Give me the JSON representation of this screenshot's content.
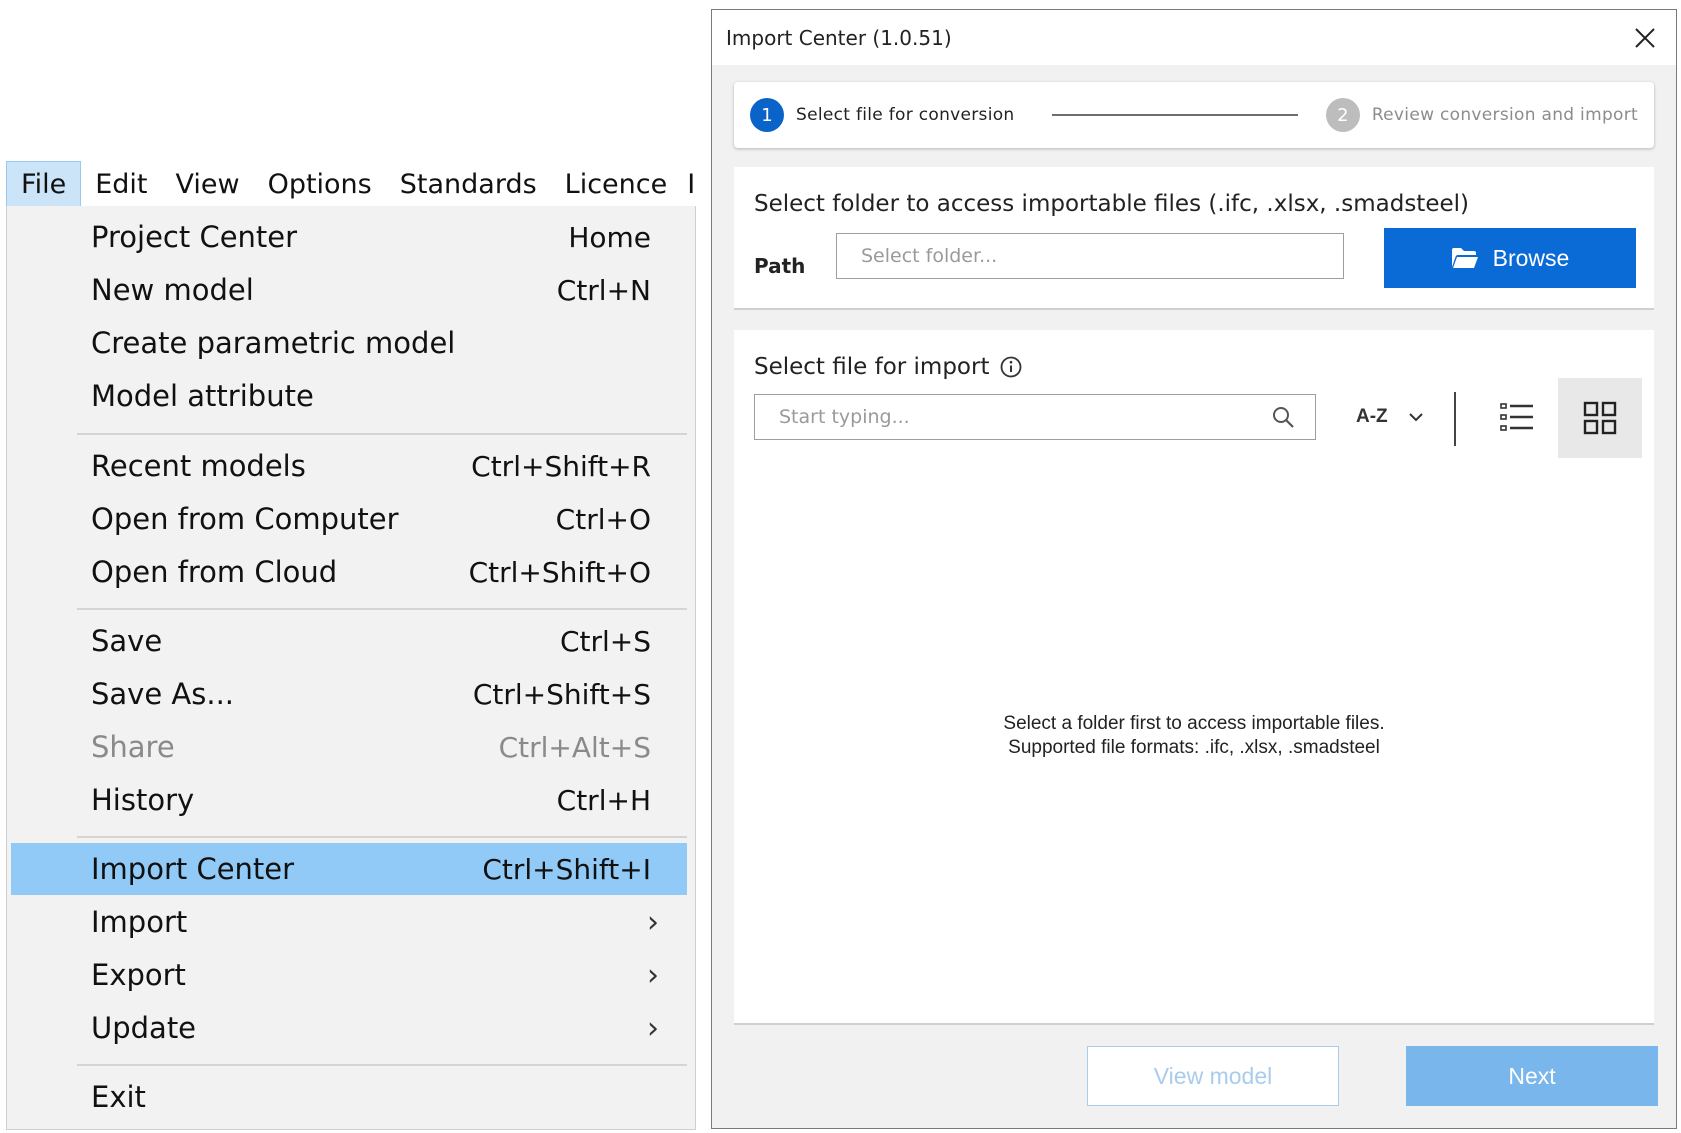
{
  "menubar": {
    "items": [
      "File",
      "Edit",
      "View",
      "Options",
      "Standards",
      "Licence",
      "I"
    ]
  },
  "file_menu": {
    "items": [
      {
        "label": "Project Center",
        "shortcut": "Home"
      },
      {
        "label": "New model",
        "shortcut": "Ctrl+N"
      },
      {
        "label": "Create parametric model",
        "shortcut": ""
      },
      {
        "label": "Model attribute",
        "shortcut": ""
      },
      {
        "label": "Recent models",
        "shortcut": "Ctrl+Shift+R"
      },
      {
        "label": "Open from Computer",
        "shortcut": "Ctrl+O"
      },
      {
        "label": "Open from Cloud",
        "shortcut": "Ctrl+Shift+O"
      },
      {
        "label": "Save",
        "shortcut": "Ctrl+S"
      },
      {
        "label": "Save As...",
        "shortcut": "Ctrl+Shift+S"
      },
      {
        "label": "Share",
        "shortcut": "Ctrl+Alt+S"
      },
      {
        "label": "History",
        "shortcut": "Ctrl+H"
      },
      {
        "label": "Import Center",
        "shortcut": "Ctrl+Shift+I"
      },
      {
        "label": "Import",
        "submenu_arrow": "›"
      },
      {
        "label": "Export",
        "submenu_arrow": "›"
      },
      {
        "label": "Update",
        "submenu_arrow": "›"
      },
      {
        "label": "Exit",
        "shortcut": ""
      }
    ]
  },
  "dialog": {
    "title": "Import Center (1.0.51)",
    "steps": [
      {
        "number": "1",
        "label": "Select file for conversion"
      },
      {
        "number": "2",
        "label": "Review conversion and import"
      }
    ],
    "folder_section": {
      "title": "Select folder to access importable files (.ifc, .xlsx, .smadsteel)",
      "path_label": "Path",
      "path_placeholder": "Select folder...",
      "browse_label": "Browse"
    },
    "file_section": {
      "title": "Select file for import",
      "search_placeholder": "Start typing...",
      "sort_label": "A-Z",
      "empty_line1": "Select a folder first to access importable files.",
      "empty_line2": "Supported file formats: .ifc, .xlsx, .smadsteel"
    },
    "footer": {
      "view_model_label": "View model",
      "next_label": "Next"
    }
  },
  "colors": {
    "menu_highlight": "#91c9f7",
    "primary_blue": "#0a6bd6",
    "next_disabled": "#78b6ec",
    "step_active": "#0a63c9",
    "step_inactive": "#bdbdbd"
  }
}
